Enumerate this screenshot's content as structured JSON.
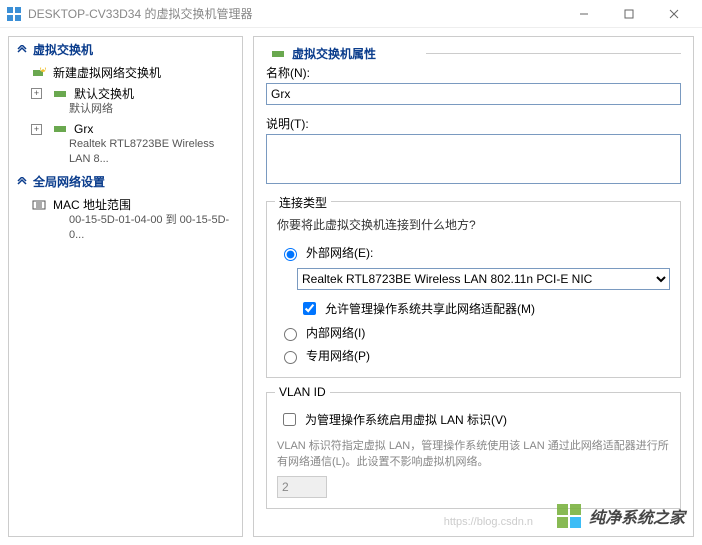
{
  "window": {
    "title": "DESKTOP-CV33D34 的虚拟交换机管理器"
  },
  "tree": {
    "section_switches": "虚拟交换机",
    "new_switch": "新建虚拟网络交换机",
    "default_switch": "默认交换机",
    "default_switch_sub": "默认网络",
    "grx": "Grx",
    "grx_sub": "Realtek RTL8723BE Wireless LAN 8...",
    "section_global": "全局网络设置",
    "mac_range": "MAC 地址范围",
    "mac_range_sub": "00-15-5D-01-04-00 到 00-15-5D-0..."
  },
  "props": {
    "header": "虚拟交换机属性",
    "name_label": "名称(N):",
    "name_value": "Grx",
    "desc_label": "说明(T):",
    "connection": {
      "title": "连接类型",
      "question": "你要将此虚拟交换机连接到什么地方?",
      "external": "外部网络(E):",
      "adapter": "Realtek RTL8723BE Wireless LAN 802.11n PCI-E NIC",
      "allow_mgmt": "允许管理操作系统共享此网络适配器(M)",
      "internal": "内部网络(I)",
      "private": "专用网络(P)"
    },
    "vlan": {
      "title": "VLAN ID",
      "enable": "为管理操作系统启用虚拟 LAN 标识(V)",
      "desc": "VLAN 标识符指定虚拟 LAN，管理操作系统使用该 LAN 通过此网络适配器进行所有网络通信(L)。此设置不影响虚拟机网络。",
      "value": "2"
    }
  },
  "footer": {
    "url": "https://blog.csdn.n",
    "brand": "纯净系统之家"
  }
}
